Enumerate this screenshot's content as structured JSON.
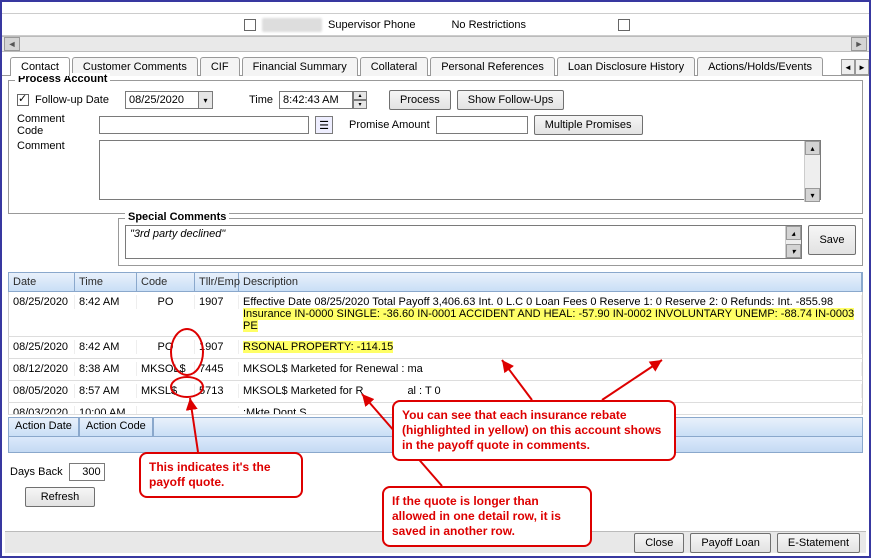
{
  "topbar": {
    "label_supervisor_phone": "Supervisor Phone",
    "label_no_restrictions": "No Restrictions"
  },
  "tabs": [
    "Contact",
    "Customer Comments",
    "CIF",
    "Financial Summary",
    "Collateral",
    "Personal References",
    "Loan Disclosure History",
    "Actions/Holds/Events"
  ],
  "process": {
    "title": "Process Account",
    "followup_label": "Follow-up Date",
    "followup_date": "08/25/2020",
    "time_label": "Time",
    "time_value": "8:42:43 AM",
    "process_btn": "Process",
    "show_followups_btn": "Show Follow-Ups",
    "comment_code_label": "Comment Code",
    "promise_amount_label": "Promise Amount",
    "multiple_promises_btn": "Multiple Promises",
    "comment_label": "Comment"
  },
  "special": {
    "title": "Special Comments",
    "text": "\"3rd party declined\"",
    "save_btn": "Save"
  },
  "left": {
    "days_back_label": "Days Back",
    "days_back_value": "300",
    "refresh_btn": "Refresh"
  },
  "grid": {
    "headers": {
      "date": "Date",
      "time": "Time",
      "code": "Code",
      "emp": "Tllr/Emp",
      "desc": "Description"
    },
    "rows": [
      {
        "date": "08/25/2020",
        "time": "8:42 AM",
        "code": "PO",
        "emp": "1907",
        "desc_pre": "Effective Date 08/25/2020  Total Payoff 3,406.63  Int. 0  L.C 0  Loan Fees 0  Reserve 1: 0  Reserve 2: 0  Refunds: Int. -855.98  ",
        "desc_hl": "Insurance IN-0000 SINGLE: -36.60 IN-0001 ACCIDENT AND HEAL: -57.90 IN-0002 INVOLUNTARY UNEMP: -88.74 IN-0003 PE"
      },
      {
        "date": "08/25/2020",
        "time": "8:42 AM",
        "code": "PO",
        "emp": "1907",
        "desc_hl": "RSONAL PROPERTY: -114.15"
      },
      {
        "date": "08/12/2020",
        "time": "8:38 AM",
        "code": "MKSOL$",
        "emp": "7445",
        "desc": "MKSOL$ Marketed for Renewal :  ma"
      },
      {
        "date": "08/05/2020",
        "time": "8:57 AM",
        "code": "MKSL$",
        "emp": "5713",
        "desc": "MKSOL$ Marketed for R",
        "desc_tail": "al :  T                                                                                                                                                 0"
      },
      {
        "date": "08/03/2020",
        "time": "10:00 AM",
        "code": "",
        "emp": "",
        "desc": ":Mkte Dont S"
      }
    ]
  },
  "action_headers": {
    "date": "Action Date",
    "code": "Action Code"
  },
  "footer": {
    "close": "Close",
    "payoff": "Payoff Loan",
    "estatement": "E-Statement"
  },
  "annotations": {
    "a1": "This indicates it's the payoff quote.",
    "a2": "You can see that each insurance rebate (highlighted in yellow) on this account shows in the payoff quote in comments.",
    "a3": "If the quote is longer than allowed in one detail row, it is saved in another row."
  }
}
